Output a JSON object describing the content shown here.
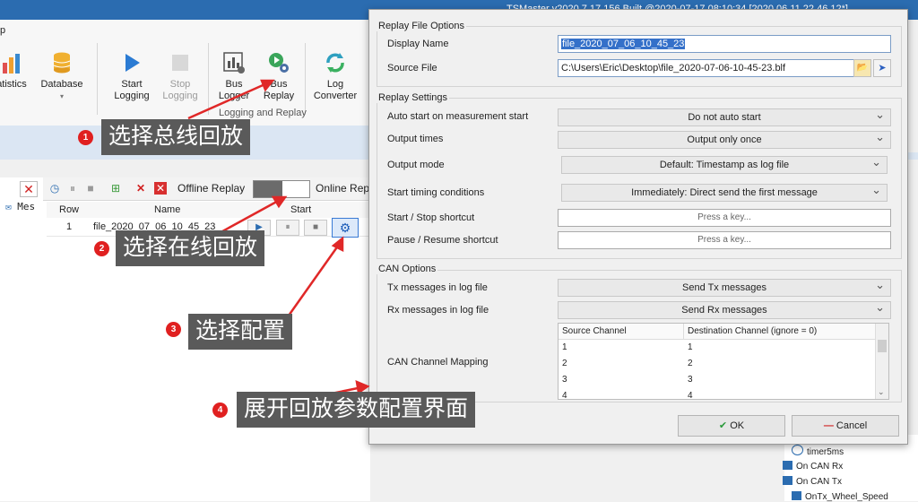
{
  "app": {
    "title": "TSMaster v2020.7.17.156  Built @2020-07-17 08:10:34 [2020.06.11.22.46.12*]",
    "menu_fragment": "p"
  },
  "ribbon": {
    "statistics": "atistics",
    "database": "Database",
    "start_logging": [
      "Start",
      "Logging"
    ],
    "stop_logging": [
      "Stop",
      "Logging"
    ],
    "bus_logger": [
      "Bus",
      "Logger"
    ],
    "bus_replay": [
      "Bus",
      "Replay"
    ],
    "log_converter": [
      "Log",
      "Converter"
    ],
    "group_label": "Logging and Replay"
  },
  "replay_panel": {
    "messages_label": "Mes",
    "offline_label": "Offline Replay",
    "online_label": "Online Rep",
    "columns": [
      "Row",
      "Name",
      "Start"
    ],
    "row": {
      "index": "1",
      "name": "file_2020_07_06_10_45_23"
    }
  },
  "tree": [
    "timer5ms",
    "On CAN Rx",
    "On CAN Tx",
    "OnTx_Wheel_Speed"
  ],
  "dialog": {
    "file_group": "Replay File Options",
    "display_name_label": "Display Name",
    "display_name_value": "file_2020_07_06_10_45_23",
    "source_file_label": "Source File",
    "source_file_value": "C:\\Users\\Eric\\Desktop\\file_2020-07-06-10-45-23.blf",
    "settings_group": "Replay Settings",
    "settings": [
      {
        "label": "Auto start on measurement start",
        "value": "Do not auto start"
      },
      {
        "label": "Output times",
        "value": "Output only once"
      },
      {
        "label": "Output mode",
        "value": "Default: Timestamp as log file"
      },
      {
        "label": "Start timing conditions",
        "value": "Immediately: Direct send the first message"
      }
    ],
    "start_stop_label": "Start / Stop shortcut",
    "start_stop_value": "Press a key...",
    "pause_label": "Pause / Resume shortcut",
    "pause_value": "Press a key...",
    "can_group": "CAN Options",
    "tx_label": "Tx messages in log file",
    "tx_value": "Send Tx messages",
    "rx_label": "Rx messages in log file",
    "rx_value": "Send Rx messages",
    "mapping_label": "CAN Channel Mapping",
    "mapping_columns": [
      "Source Channel",
      "Destination Channel (ignore = 0)"
    ],
    "mapping_rows": [
      [
        "1",
        "1"
      ],
      [
        "2",
        "2"
      ],
      [
        "3",
        "3"
      ],
      [
        "4",
        "4"
      ]
    ],
    "ok_label": "OK",
    "cancel_label": "Cancel"
  },
  "callouts": [
    {
      "number": "1",
      "text": "选择总线回放"
    },
    {
      "number": "2",
      "text": "选择在线回放"
    },
    {
      "number": "3",
      "text": "选择配置"
    },
    {
      "number": "4",
      "text": "展开回放参数配置界面"
    }
  ],
  "colors": {
    "accent": "#2b6cb0",
    "callout_bg": "#5a5a5a",
    "badge": "#e02020",
    "arrow": "#e02828"
  }
}
